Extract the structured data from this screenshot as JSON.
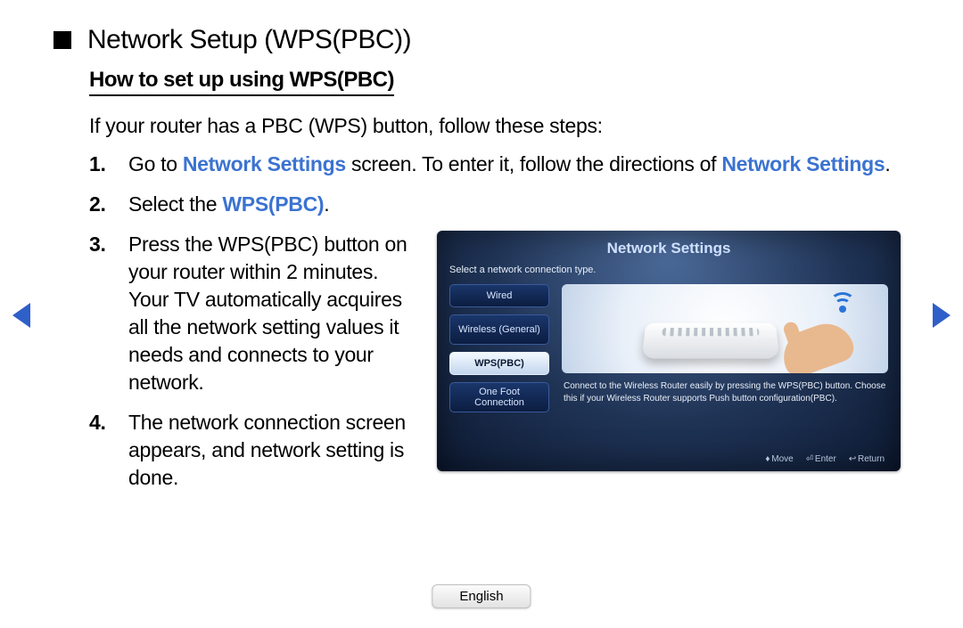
{
  "title": "Network Setup (WPS(PBC))",
  "subtitle": "How to set up using WPS(PBC)",
  "intro": "If your router has a PBC (WPS) button, follow these steps:",
  "steps": [
    {
      "num": "1.",
      "pre": "Go to ",
      "hl1": "Network Settings",
      "mid": " screen. To enter it, follow the directions of ",
      "hl2": "Network Settings",
      "post": "."
    },
    {
      "num": "2.",
      "pre": "Select the ",
      "hl1": "WPS(PBC)",
      "post": "."
    },
    {
      "num": "3.",
      "text": "Press the WPS(PBC) button on your router within 2 minutes. Your TV automatically acquires all the network setting values it needs and connects to your network."
    },
    {
      "num": "4.",
      "text": "The network connection screen appears, and network setting is done."
    }
  ],
  "tv": {
    "title": "Network Settings",
    "sub": "Select a network connection type.",
    "menu": {
      "wired": "Wired",
      "wireless": "Wireless (General)",
      "wpspbc": "WPS(PBC)",
      "onefoot": "One Foot Connection"
    },
    "desc": "Connect to the Wireless Router easily by pressing the WPS(PBC) button. Choose this if your Wireless Router supports Push button configuration(PBC).",
    "footer": {
      "move": "Move",
      "enter": "Enter",
      "return": "Return"
    }
  },
  "language": "English"
}
